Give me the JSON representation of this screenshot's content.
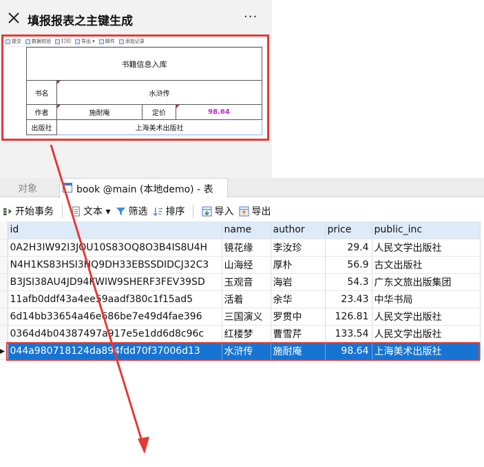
{
  "mobile": {
    "title": "填报报表之主键生成",
    "more": "···",
    "toolbar": [
      "提交",
      "数据校验",
      "打印",
      "导出 ▾",
      "邮件",
      "添加记录"
    ],
    "form": {
      "heading": "书籍信息入库",
      "name_label": "书名",
      "name_value": "水浒传",
      "author_label": "作者",
      "author_value": "施耐庵",
      "price_label": "定价",
      "price_value": "98.64",
      "press_label": "出版社",
      "press_value": "上海美术出版社"
    }
  },
  "tabs": {
    "objects": "对象",
    "book": "book @main (本地demo) - 表"
  },
  "tools": {
    "begin_txn": "开始事务",
    "text": "文本 ▾",
    "filter": "筛选",
    "sort": "排序",
    "import": "导入",
    "export": "导出"
  },
  "table": {
    "columns": [
      "id",
      "name",
      "author",
      "price",
      "public_inc"
    ],
    "rows": [
      [
        "0A2H3IW92I3JQU10S83OQ8O3B4IS8U4H",
        "镜花缘",
        "李汝珍",
        "29.4",
        "人民文学出版社"
      ],
      [
        "N4H1KS83HSI3HQ9DH33EBSSDIDCJ32C3",
        "山海经",
        "厚朴",
        "56.9",
        "古文出版社"
      ],
      [
        "B3JSI38AU4JD94KWIW9SHERF3FEV39SD",
        "玉观音",
        "海岩",
        "54.3",
        "广东文旅出版集团"
      ],
      [
        "11afb0ddf43a4ee59aadf380c1f15ad5",
        "活着",
        "余华",
        "23.43",
        "中华书局"
      ],
      [
        "6d14bb33654a46e686be7e49d4fae396",
        "三国演义",
        "罗贯中",
        "126.81",
        "人民文学出版社"
      ],
      [
        "0364d4b04387497a917e5e1dd6d8c96c",
        "红楼梦",
        "曹雪芹",
        "133.54",
        "人民文学出版社"
      ],
      [
        "044a980718124da894fdd70f37006d13",
        "水浒传",
        "施耐庵",
        "98.64",
        "上海美术出版社"
      ]
    ],
    "selected_row": 6,
    "selected_marker": "▸"
  },
  "colors": {
    "highlight": "#e53935",
    "selection": "#1874d2",
    "price_text": "#c026d3"
  }
}
